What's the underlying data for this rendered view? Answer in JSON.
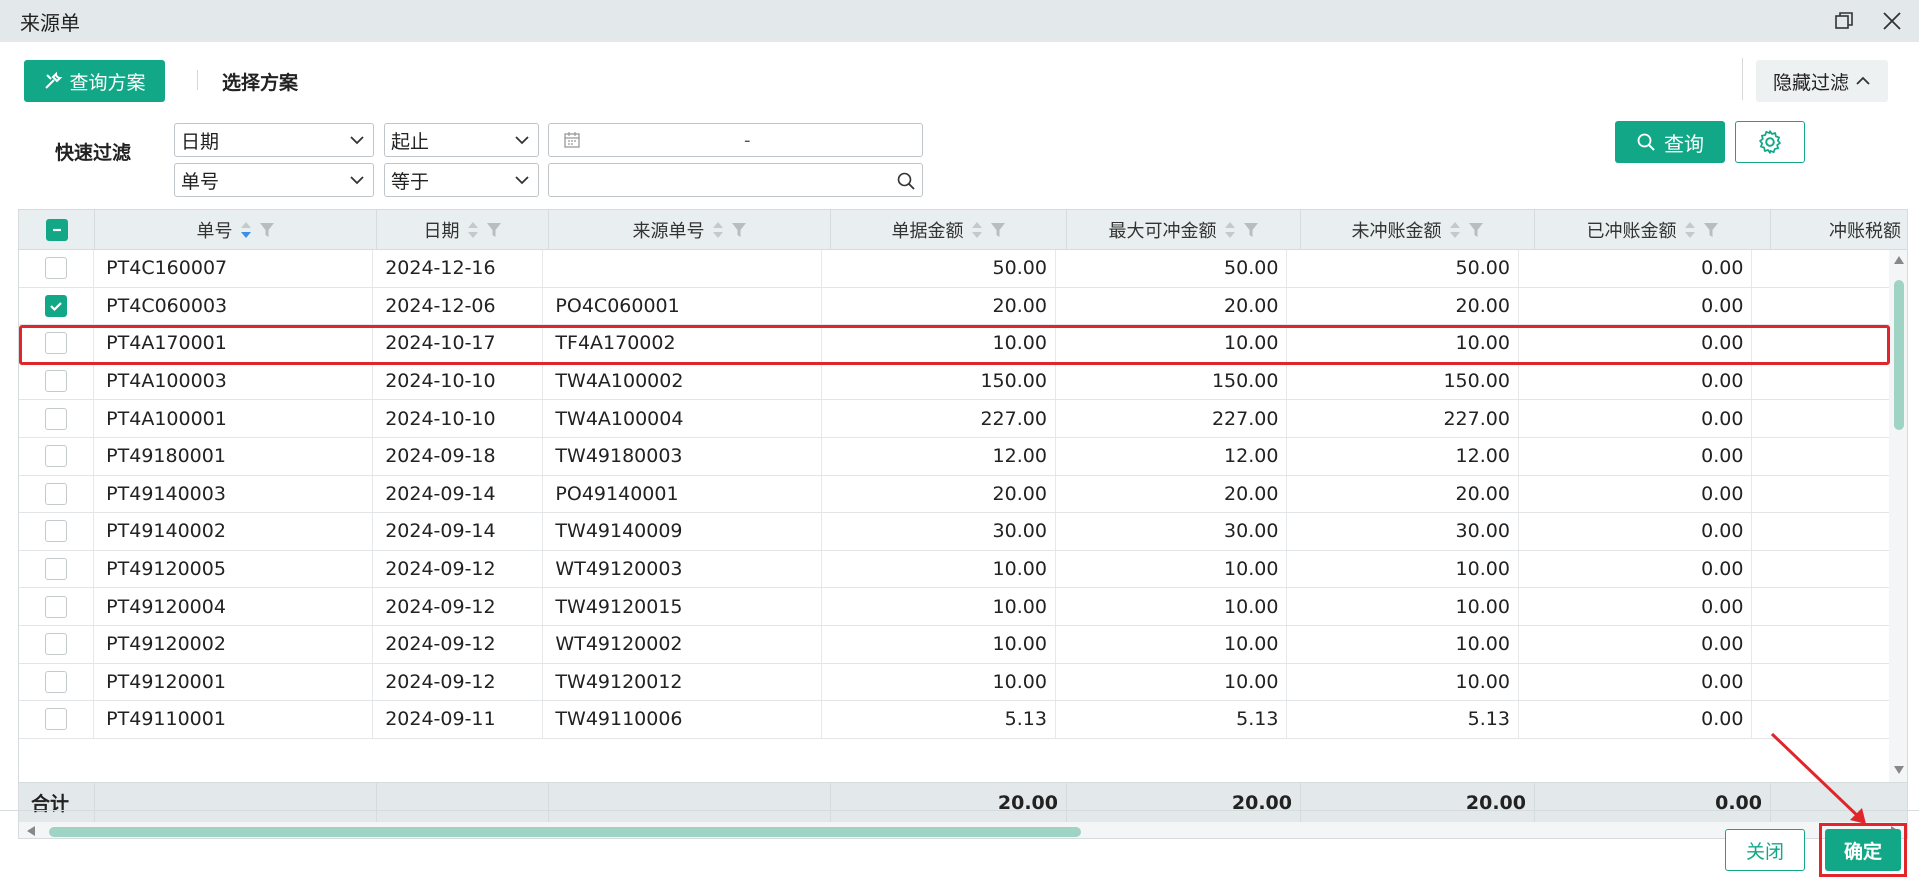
{
  "window": {
    "title": "来源单"
  },
  "toolbar": {
    "scheme_button": "查询方案",
    "scheme_select_label": "选择方案",
    "hide_filter": "隐藏过滤"
  },
  "filter": {
    "label": "快速过滤",
    "row1": {
      "field": "日期",
      "operator": "起止",
      "date_separator": "-"
    },
    "row2": {
      "field": "单号",
      "operator": "等于",
      "value": ""
    },
    "query_button": "查询"
  },
  "table": {
    "columns": [
      "单号",
      "日期",
      "来源单号",
      "单据金额",
      "最大可冲金额",
      "未冲账金额",
      "已冲账金额",
      "冲账税额"
    ],
    "rows": [
      {
        "checked": false,
        "no": "PT4C160007",
        "date": "2024-12-16",
        "src": "",
        "amount": "50.00",
        "max": "50.00",
        "unoff": "50.00",
        "off": "0.00"
      },
      {
        "checked": true,
        "no": "PT4C060003",
        "date": "2024-12-06",
        "src": "PO4C060001",
        "amount": "20.00",
        "max": "20.00",
        "unoff": "20.00",
        "off": "0.00"
      },
      {
        "checked": false,
        "no": "PT4A170001",
        "date": "2024-10-17",
        "src": "TF4A170002",
        "amount": "10.00",
        "max": "10.00",
        "unoff": "10.00",
        "off": "0.00"
      },
      {
        "checked": false,
        "no": "PT4A100003",
        "date": "2024-10-10",
        "src": "TW4A100002",
        "amount": "150.00",
        "max": "150.00",
        "unoff": "150.00",
        "off": "0.00"
      },
      {
        "checked": false,
        "no": "PT4A100001",
        "date": "2024-10-10",
        "src": "TW4A100004",
        "amount": "227.00",
        "max": "227.00",
        "unoff": "227.00",
        "off": "0.00"
      },
      {
        "checked": false,
        "no": "PT49180001",
        "date": "2024-09-18",
        "src": "TW49180003",
        "amount": "12.00",
        "max": "12.00",
        "unoff": "12.00",
        "off": "0.00"
      },
      {
        "checked": false,
        "no": "PT49140003",
        "date": "2024-09-14",
        "src": "PO49140001",
        "amount": "20.00",
        "max": "20.00",
        "unoff": "20.00",
        "off": "0.00"
      },
      {
        "checked": false,
        "no": "PT49140002",
        "date": "2024-09-14",
        "src": "TW49140009",
        "amount": "30.00",
        "max": "30.00",
        "unoff": "30.00",
        "off": "0.00"
      },
      {
        "checked": false,
        "no": "PT49120005",
        "date": "2024-09-12",
        "src": "WT49120003",
        "amount": "10.00",
        "max": "10.00",
        "unoff": "10.00",
        "off": "0.00"
      },
      {
        "checked": false,
        "no": "PT49120004",
        "date": "2024-09-12",
        "src": "TW49120015",
        "amount": "10.00",
        "max": "10.00",
        "unoff": "10.00",
        "off": "0.00"
      },
      {
        "checked": false,
        "no": "PT49120002",
        "date": "2024-09-12",
        "src": "WT49120002",
        "amount": "10.00",
        "max": "10.00",
        "unoff": "10.00",
        "off": "0.00"
      },
      {
        "checked": false,
        "no": "PT49120001",
        "date": "2024-09-12",
        "src": "TW49120012",
        "amount": "10.00",
        "max": "10.00",
        "unoff": "10.00",
        "off": "0.00"
      },
      {
        "checked": false,
        "no": "PT49110001",
        "date": "2024-09-11",
        "src": "TW49110006",
        "amount": "5.13",
        "max": "5.13",
        "unoff": "5.13",
        "off": "0.00"
      }
    ],
    "footer": {
      "label": "合计",
      "amount": "20.00",
      "max": "20.00",
      "unoff": "20.00",
      "off": "0.00"
    }
  },
  "actions": {
    "close": "关闭",
    "ok": "确定"
  },
  "colors": {
    "accent": "#12a887",
    "highlight": "#e0262a"
  }
}
